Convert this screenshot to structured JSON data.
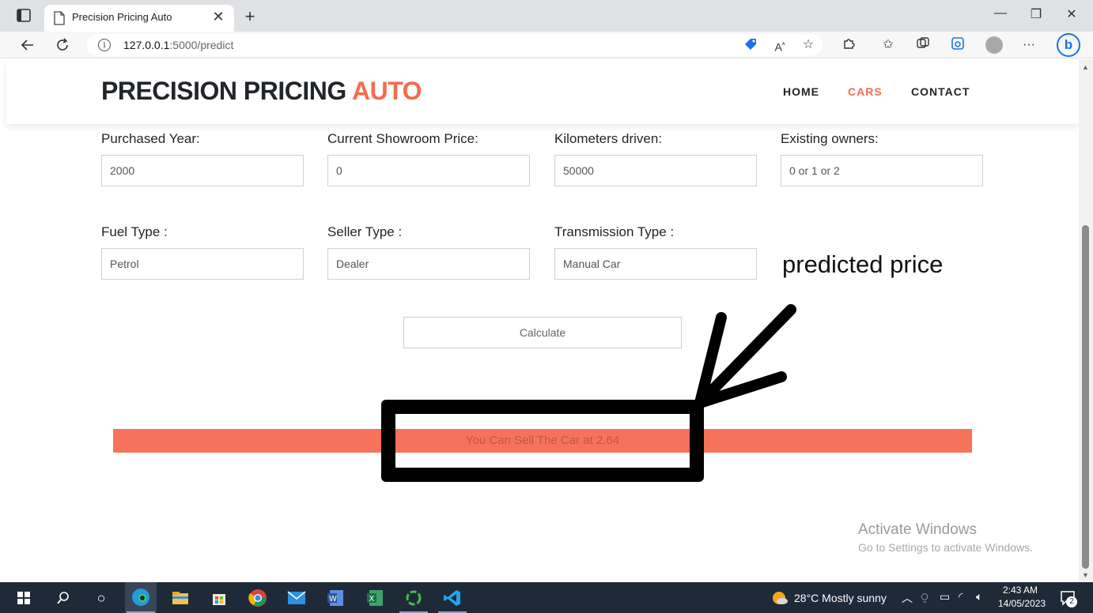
{
  "browser": {
    "tab_title": "Precision Pricing Auto",
    "new_tab": "+",
    "tab_close": "✕",
    "url_host": "127.0.0.1",
    "url_path": ":5000/predict",
    "window_minimize": "—",
    "window_restore": "❐",
    "window_close": "✕",
    "more_menu": "···"
  },
  "site": {
    "logo_main": "PRECISION PRICING ",
    "logo_accent": "AUTO",
    "nav": {
      "home": "HOME",
      "cars": "CARS",
      "contact": "CONTACT"
    }
  },
  "form": {
    "purchased_year": {
      "label": "Purchased Year:",
      "value": "2000"
    },
    "showroom_price": {
      "label": "Current Showroom Price:",
      "value": "0"
    },
    "kilometers": {
      "label": "Kilometers driven:",
      "value": "50000"
    },
    "owners": {
      "label": "Existing owners:",
      "value": "0 or 1 or 2"
    },
    "fuel_type": {
      "label": "Fuel Type :",
      "value": "Petrol"
    },
    "seller_type": {
      "label": "Seller Type :",
      "value": "Dealer"
    },
    "transmission": {
      "label": "Transmission Type :",
      "value": "Manual Car"
    },
    "calculate_label": "Calculate"
  },
  "result": {
    "text": "You Can Sell The Car at 2.64"
  },
  "annotation": {
    "text": "predicted price"
  },
  "watermark": {
    "title": "Activate Windows",
    "subtitle": "Go to Settings to activate Windows."
  },
  "taskbar": {
    "weather": "28°C  Mostly sunny",
    "time": "2:43 AM",
    "date": "14/05/2023",
    "notification_count": "2"
  },
  "colors": {
    "accent": "#f36c4f",
    "result_bar": "#f5735a",
    "taskbar": "#1f2a38"
  }
}
